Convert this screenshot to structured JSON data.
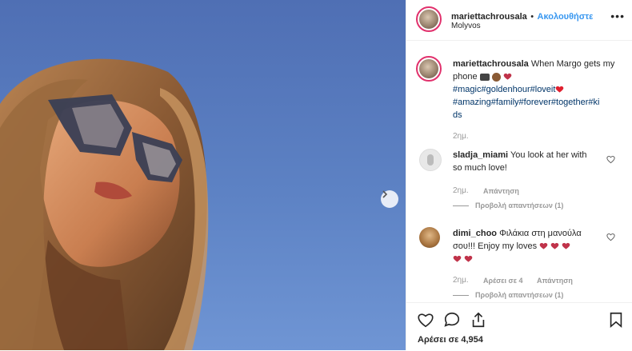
{
  "post": {
    "author": "mariettachrousala",
    "separator": "•",
    "follow_label": "Ακολουθήστε",
    "location": "Molyvos",
    "caption_text": "When Margo gets my phone",
    "caption_hashtags_line1": "#magic#goldenhour#loveit",
    "caption_hashtags_line2": "#amazing#family#forever#together#ki",
    "caption_hashtags_line3": "ds",
    "caption_time": "2ημ.",
    "likes_label": "Αρέσει σε 4,954"
  },
  "comments": [
    {
      "user": "sladja_miami",
      "text_line1": "You look at her with",
      "text_line2": "so much love!",
      "time": "2ημ.",
      "reply_label": "Απάντηση",
      "view_replies": "Προβολή απαντήσεων (1)"
    },
    {
      "user": "dimi_choo",
      "text_line1": "Φιλάκια στη μανούλα",
      "text_line2": "σου!!! Enjoy my loves",
      "time": "2ημ.",
      "likes": "Αρέσει σε 4",
      "reply_label": "Απάντηση",
      "view_replies": "Προβολή απαντήσεων (1)"
    }
  ],
  "icons": [
    "more-icon",
    "next-arrow-icon",
    "heart-icon",
    "comment-icon",
    "share-icon",
    "bookmark-icon",
    "camera-emoji-icon",
    "monkey-emoji-icon",
    "heart-emoji-icon",
    "like-comment-icon"
  ],
  "colors": {
    "link": "#3897f0",
    "hashtag": "#003569",
    "heart": "#ed4956",
    "ring": "#e1306c"
  }
}
